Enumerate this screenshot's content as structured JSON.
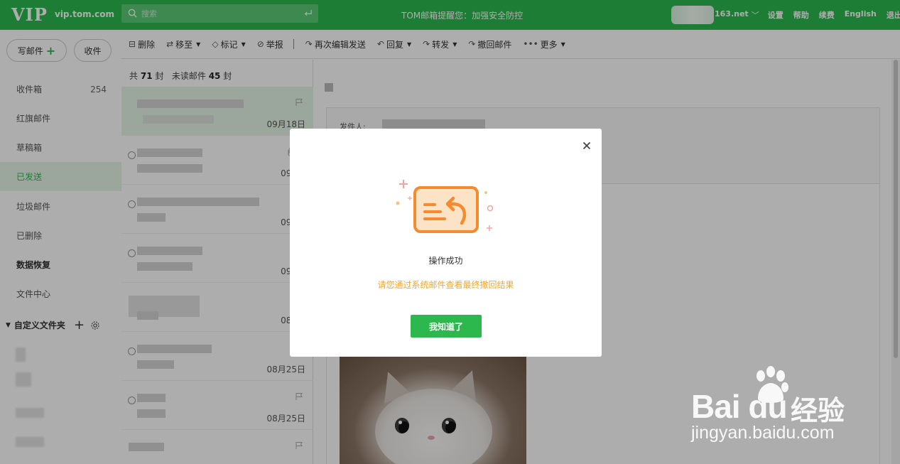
{
  "app": {
    "logo": "VIP",
    "domain": "vip.tom.com"
  },
  "search": {
    "placeholder": "搜索"
  },
  "notice": "TOM邮箱提醒您：加强安全防控",
  "account": {
    "suffix": "163.net",
    "chevron": "﹀"
  },
  "top_links": [
    "设置",
    "帮助",
    "续费",
    "English",
    "退出"
  ],
  "compose": {
    "write_label": "写邮件",
    "receive_label": "收件"
  },
  "folders": [
    {
      "label": "收件箱",
      "count": "254"
    },
    {
      "label": "红旗邮件"
    },
    {
      "label": "草稿箱"
    },
    {
      "label": "已发送",
      "active": true
    },
    {
      "label": "垃圾邮件"
    },
    {
      "label": "已删除"
    },
    {
      "label": "数据恢复",
      "bold": true
    },
    {
      "label": "文件中心"
    }
  ],
  "custom_folders": {
    "label": "自定义文件夹"
  },
  "toolbar": {
    "delete": "删除",
    "move": "移至",
    "mark": "标记",
    "report": "举报",
    "reedit": "再次编辑发送",
    "reply": "回复",
    "forward": "转发",
    "recall": "撤回邮件",
    "more": "更多"
  },
  "list": {
    "total_prefix": "共",
    "total": "71",
    "total_unit": "封",
    "unread_prefix": "未读邮件",
    "unread": "45",
    "unread_unit": "封",
    "items": [
      {
        "date": "09月18日"
      },
      {
        "date": "09月1"
      },
      {
        "date": "09月0"
      },
      {
        "date": "09月0"
      },
      {
        "date": "08月3"
      },
      {
        "date": "08月25日"
      },
      {
        "date": "08月25日"
      },
      {
        "date": ""
      }
    ]
  },
  "reader": {
    "sender_label": "发件人:"
  },
  "modal": {
    "title": "操作成功",
    "subtitle": "请您通过系统邮件查看最终撤回结果",
    "ok_label": "我知道了"
  },
  "watermark": {
    "brand": "Bai du",
    "cn": "经验",
    "url": "jingyan.baidu.com"
  },
  "colors": {
    "brand_green": "#2db84d",
    "accent_orange": "#f5a623",
    "active_bg": "#e5f5e8"
  }
}
